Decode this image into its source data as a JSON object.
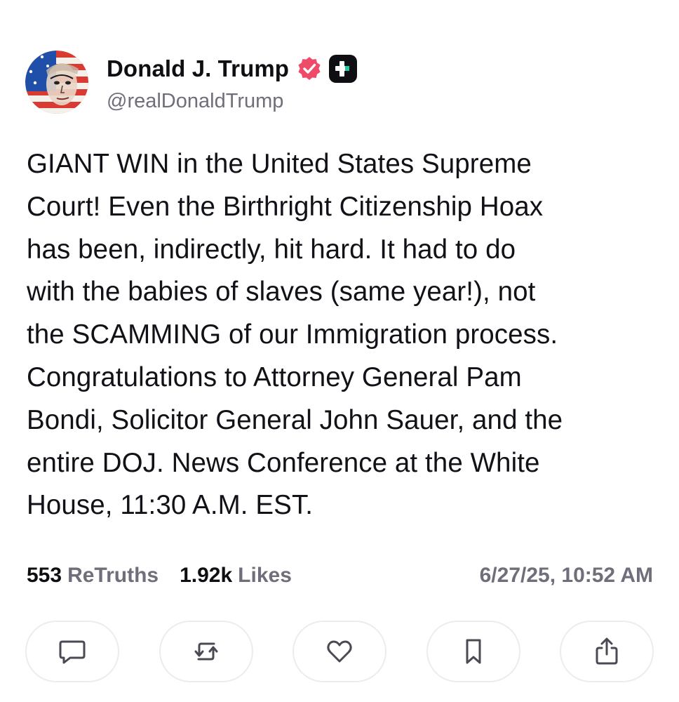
{
  "author": {
    "display_name": "Donald J. Trump",
    "handle": "@realDonaldTrump"
  },
  "post": {
    "lines": [
      "GIANT WIN in the United States Supreme",
      "Court! Even the Birthright Citizenship Hoax",
      "has been, indirectly, hit hard. It had to do",
      "with the babies of slaves (same year!), not",
      "the SCAMMING of our Immigration process.",
      "Congratulations to Attorney General Pam",
      "Bondi, Solicitor General John Sauer, and the",
      "entire DOJ. News Conference at the White",
      "House, 11:30 A.M. EST."
    ]
  },
  "stats": {
    "retruths_count": "553",
    "retruths_label": "ReTruths",
    "likes_count": "1.92k",
    "likes_label": "Likes",
    "timestamp": "6/27/25, 10:52 AM"
  },
  "actions": [
    {
      "icon": "reply-icon"
    },
    {
      "icon": "retruth-icon"
    },
    {
      "icon": "like-icon"
    },
    {
      "icon": "bookmark-icon"
    },
    {
      "icon": "share-icon"
    }
  ],
  "colors": {
    "text": "#0e0e13",
    "muted": "#6f6f7b",
    "verified": "#f04a6a",
    "border": "#ececf0"
  }
}
